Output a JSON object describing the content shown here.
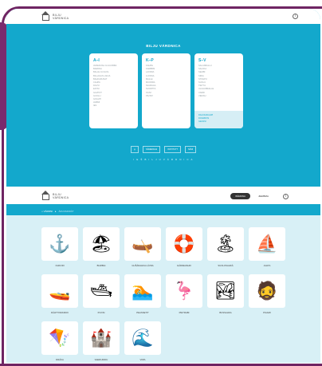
{
  "site": {
    "logo_text": "BILJU\nVÁRDNICA"
  },
  "screen1": {
    "title": "BILJU VÁRDNICA",
    "help": "i",
    "columns": [
      {
        "heading": "A–I",
        "items": [
          "AVREDUSA JA GUOBBA",
          "BÁRDNA",
          "BÁLLE JA GUOL",
          "BILLÁGÁS LÁNJA",
          "BÁHKÁDUSAT",
          "CÁHPA",
          "DÁVVI",
          "EATNI",
          "GÁVPOT",
          "GUOLLI",
          "GOAHTI",
          "HÁBMI",
          "IEŠ"
        ]
      },
      {
        "heading": "K–P",
        "items": [
          "KAHPE",
          "KÁRBBIS",
          "LÁVDDA",
          "LUOSSA",
          "MÁLLE",
          "MUORRA",
          "NJÁRGGA",
          "NUORTTA",
          "OAIVI",
          "PIHTAT"
        ]
      },
      {
        "heading": "S–V",
        "items": [
          "SÁLAŠBÁLLU",
          "SÁLKKÁ",
          "SEAIBI",
          "SIIDA",
          "STOHPU",
          "SUOLU",
          "TIETTÁ",
          "ULGGOBEALLE",
          "VÁRRI",
          "VIESSU"
        ]
      }
    ],
    "card3_footer": [
      "DÁLKKÁDÁHPI",
      "DOARROS",
      "GEASSI"
    ],
    "footer_logos": [
      "◎",
      "SÁMEDIGGI",
      "INSTITUTT",
      "SÁMI"
    ],
    "tagline": "I E Š B I L J U V Á R D N I C A"
  },
  "screen2": {
    "header_pill_active": "BÁRDNA",
    "header_pill": "JIERBMA",
    "help": "i",
    "breadcrumb_home": "VÁRDNI",
    "breadcrumb_current": "ÁRUVAIDDÁT",
    "tiles": [
      {
        "icon": "⚓",
        "label": "OHKORI"
      },
      {
        "icon": "🏖",
        "label": "BUMBAI"
      },
      {
        "icon": "🛶",
        "label": "GUŠÁDAHKA LÁVDA"
      },
      {
        "icon": "🛟",
        "label": "GÁDDEVAHKI"
      },
      {
        "icon": "🏝",
        "label": "SUOLOSAHKÁ"
      },
      {
        "icon": "⛵",
        "label": "JAHTA"
      },
      {
        "icon": "🚤",
        "label": "DÁHTTOMASKKI"
      },
      {
        "icon": "🛥",
        "label": "PUOSI"
      },
      {
        "icon": "🏊",
        "label": "PEASSETIT"
      },
      {
        "icon": "🦩",
        "label": "PIETRABI"
      },
      {
        "icon": "🏞",
        "label": "BUSSAHKA"
      },
      {
        "icon": "🧔",
        "label": "PIAAMI"
      },
      {
        "icon": "🪁",
        "label": "DRÁKA"
      },
      {
        "icon": "🏰",
        "label": "SAĐDUIDDU"
      },
      {
        "icon": "🌊",
        "label": "VIIPA"
      }
    ]
  },
  "colors": {
    "brand_blue": "#13a8cc",
    "frame_purple": "#6f2563",
    "background_light": "#d8f0f6"
  }
}
